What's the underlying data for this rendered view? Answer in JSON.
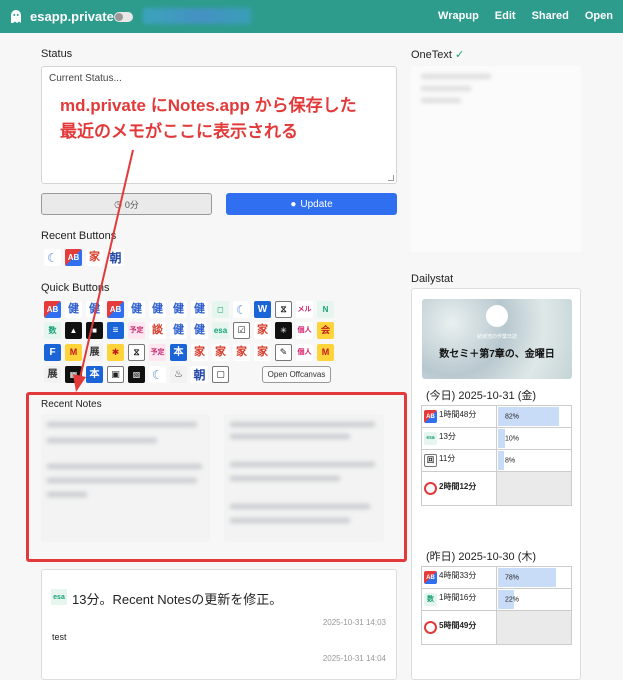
{
  "app": {
    "title": "esapp.private"
  },
  "nav": {
    "links": [
      "Wrapup",
      "Edit",
      "Shared",
      "Open"
    ]
  },
  "status": {
    "label": "Status",
    "placeholder": "Current Status...",
    "timer_label": "0分",
    "update_label": "Update"
  },
  "annotation": {
    "line1": "md.private にNotes.app から保存した",
    "line2": "最近のメモがここに表示される",
    "color": "#e23a3a"
  },
  "recent_buttons": {
    "label": "Recent Buttons"
  },
  "quick_buttons": {
    "label": "Quick Buttons",
    "open_offcanvas": "Open Offcanvas"
  },
  "recent_notes": {
    "label": "Recent Notes"
  },
  "onetext": {
    "label": "OneText"
  },
  "dailystat": {
    "label": "Dailystat",
    "banner_sub": "結城浩の作業日誌",
    "banner_title": "数セミ＋第7章の、金曜日",
    "today": {
      "heading": "(今日) 2025-10-31 (金)",
      "rows": [
        {
          "icon": "AB",
          "label": "1時間48分",
          "pct": "82%",
          "value": 0.82
        },
        {
          "icon": "esa",
          "label": "13分",
          "pct": "10%",
          "value": 0.1
        },
        {
          "icon": "回",
          "label": "11分",
          "pct": "8%",
          "value": 0.08
        }
      ],
      "total": "2時間12分"
    },
    "yesterday": {
      "heading": "(昨日) 2025-10-30 (木)",
      "rows": [
        {
          "icon": "AB",
          "label": "4時間33分",
          "pct": "78%",
          "value": 0.78
        },
        {
          "icon": "数",
          "label": "1時間16分",
          "pct": "22%",
          "value": 0.22
        }
      ],
      "total": "5時間49分"
    }
  },
  "timeline": {
    "title": "13分。Recent Notesの更新を修正。",
    "ts1": "2025-10-31 14:03",
    "body": "test",
    "ts2": "2025-10-31 14:04"
  },
  "colors": {
    "navbar": "#2d9c8c",
    "primary": "#2f6ff0",
    "highlight": "#e23a3a"
  }
}
